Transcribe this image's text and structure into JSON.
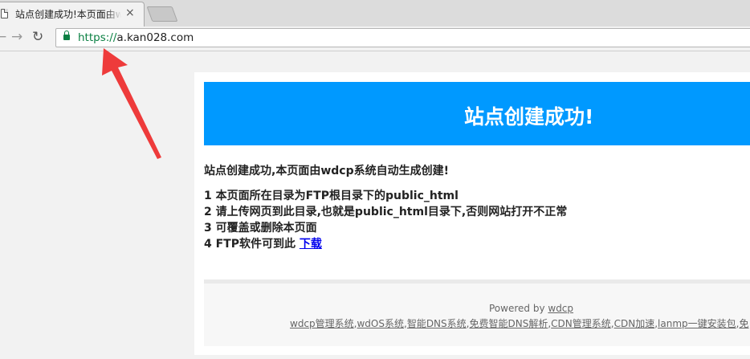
{
  "browser": {
    "tab_title": "站点创建成功!本页面由wdcp系统自动生成创建!",
    "close_glyph": "×",
    "back_glyph": "←",
    "forward_glyph": "→",
    "reload_glyph": "↻",
    "url_scheme": "https://",
    "url_host": "a.kan028.com",
    "secure_color": "#0b8043"
  },
  "annotation": {
    "arrow_color": "#ee3b3b"
  },
  "page": {
    "banner_color": "#0099ff",
    "heading": "站点创建成功!",
    "intro": "站点创建成功,本页面由wdcp系统自动生成创建!",
    "steps": [
      "1 本页面所在目录为FTP根目录下的public_html",
      "2 请上传网页到此目录,也就是public_html目录下,否则网站打开不正常",
      "3 可覆盖或删除本页面",
      "4 FTP软件可到此 "
    ],
    "download_link": "下载",
    "footer": {
      "powered_prefix": "Powered by ",
      "powered_link": "wdcp",
      "links": [
        "wdcp管理系统",
        "wdOS系统",
        "智能DNS系统",
        "免费智能DNS解析",
        "CDN管理系统",
        "CDN加速",
        "lanmp一键安装包",
        "免"
      ],
      "separator": ","
    }
  }
}
